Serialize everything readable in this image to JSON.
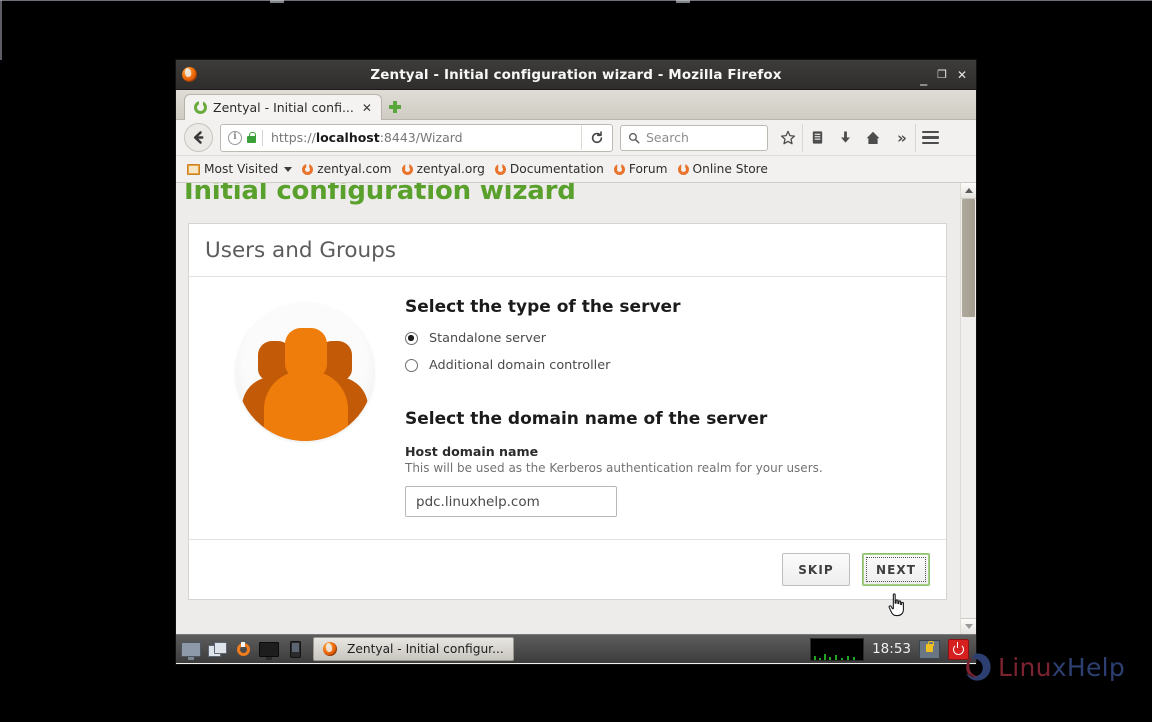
{
  "window": {
    "title": "Zentyal - Initial configuration wizard - Mozilla Firefox",
    "app_icon": "firefox-icon",
    "buttons": {
      "minimize": "_",
      "maximize": "❐",
      "close": "✕"
    }
  },
  "tabs": [
    {
      "label": "Zentyal - Initial confi...",
      "icon": "zentyal-icon",
      "close": "✕",
      "active": true
    }
  ],
  "newtab": {
    "label": "+",
    "icon": "new-tab-plus-icon"
  },
  "navbar": {
    "back_icon": "back-arrow-icon",
    "identity_icon": "page-info-icon",
    "lock_icon": "secure-lock-icon",
    "url_scheme": "https://",
    "url_host": "localhost",
    "url_rest": ":8443/Wizard",
    "reload_icon": "reload-icon",
    "search_placeholder": "Search",
    "search_icon": "search-icon",
    "icons": [
      "bookmark-star-icon",
      "reader-list-icon",
      "downloads-icon",
      "home-icon",
      "overflow-chevron-icon",
      "menu-hamburger-icon"
    ]
  },
  "bookmarks": [
    {
      "label": "Most Visited",
      "icon": "folder-icon",
      "has_caret": true
    },
    {
      "label": "zentyal.com",
      "icon": "zentyal-icon",
      "has_caret": false
    },
    {
      "label": "zentyal.org",
      "icon": "zentyal-icon",
      "has_caret": false
    },
    {
      "label": "Documentation",
      "icon": "zentyal-icon",
      "has_caret": false
    },
    {
      "label": "Forum",
      "icon": "zentyal-icon",
      "has_caret": false
    },
    {
      "label": "Online Store",
      "icon": "zentyal-icon",
      "has_caret": false
    }
  ],
  "page": {
    "title": "Initial configuration wizard",
    "title_color": "#5aa02c",
    "card": {
      "heading": "Users and Groups",
      "avatar_icon": "users-group-icon",
      "section1_title": "Select the type of the server",
      "radios": [
        {
          "label": "Standalone server",
          "checked": true
        },
        {
          "label": "Additional domain controller",
          "checked": false
        }
      ],
      "section2_title": "Select the domain name of the server",
      "field_label": "Host domain name",
      "field_help": "This will be used as the Kerberos authentication realm for your users.",
      "field_value": "pdc.linuxhelp.com",
      "field_placeholder": "",
      "buttons": {
        "skip": "SKIP",
        "next": "NEXT"
      }
    }
  },
  "scrollbar": {
    "up_icon": "scroll-up-arrow-icon",
    "down_icon": "scroll-down-arrow-icon"
  },
  "taskbar": {
    "launchers": [
      "display-icon",
      "windows-stack-icon",
      "zentyal-icon",
      "monitor-icon",
      "device-icon"
    ],
    "task": {
      "label": "Zentyal - Initial configur...",
      "icon": "firefox-icon"
    },
    "tray": {
      "graph_icon": "network-graph-icon",
      "clock": "18:53",
      "lock_icon": "lock-screen-icon",
      "power_icon": "power-off-icon"
    }
  },
  "watermark": {
    "text_a": "Linu",
    "text_b": "xHelp",
    "mark_icon": "linuxhelp-logo-icon"
  },
  "cursor": {
    "icon": "hand-pointer-cursor"
  }
}
